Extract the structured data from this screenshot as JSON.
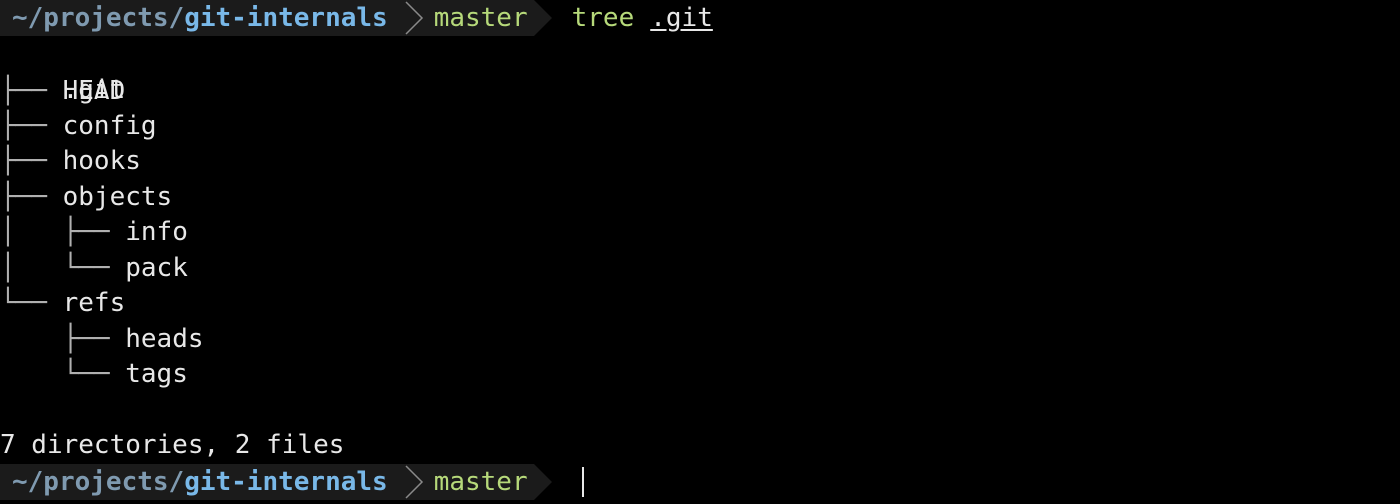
{
  "window": {
    "background": "#000000"
  },
  "prompt_top": {
    "path_prefix": "~/projects/",
    "path_dir": "git-internals",
    "branch": "master",
    "command": "tree",
    "argument": ".git"
  },
  "tree": {
    "root": ".git",
    "rows": [
      {
        "branch": "├── ",
        "name": "HEAD"
      },
      {
        "branch": "├── ",
        "name": "config"
      },
      {
        "branch": "├── ",
        "name": "hooks"
      },
      {
        "branch": "├── ",
        "name": "objects"
      },
      {
        "branch": "│   ├── ",
        "name": "info"
      },
      {
        "branch": "│   └── ",
        "name": "pack"
      },
      {
        "branch": "└── ",
        "name": "refs"
      },
      {
        "branch": "    ├── ",
        "name": "heads"
      },
      {
        "branch": "    └── ",
        "name": "tags"
      }
    ],
    "summary": "7 directories, 2 files"
  },
  "prompt_bottom": {
    "path_prefix": "~/projects/",
    "path_dir": "git-internals",
    "branch": "master"
  },
  "colors": {
    "path_prefix": "#7f9ab0",
    "path_dir": "#79b8e8",
    "branch": "#b6d97a",
    "segment_bg": "#1b1b1b",
    "text": "#e8e8e8"
  }
}
